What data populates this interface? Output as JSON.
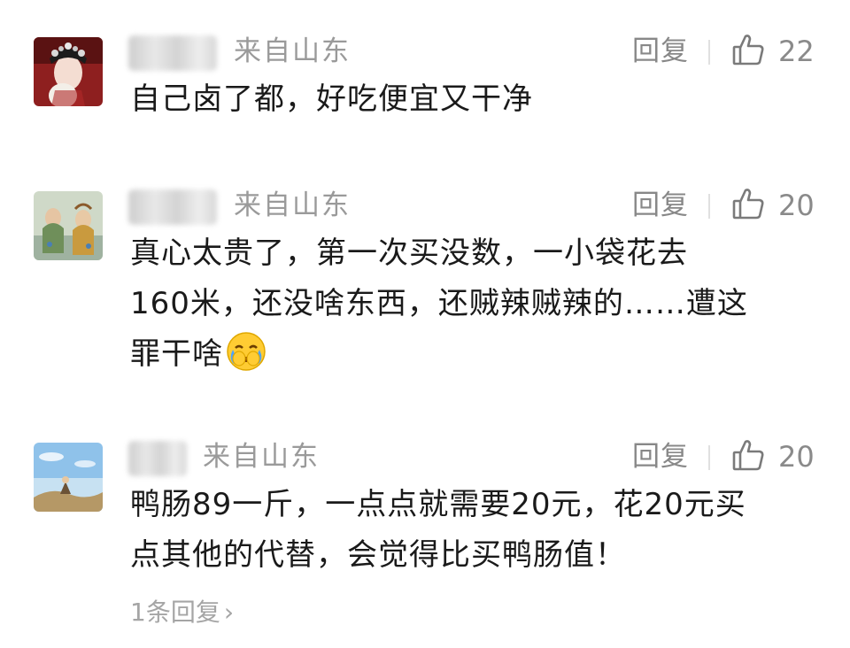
{
  "comments": [
    {
      "location": "来自山东",
      "reply_label": "回复",
      "likes": "22",
      "lines": [
        "自己卤了都，好吃便宜又干净"
      ],
      "avatar_icon": "opera-performer-avatar"
    },
    {
      "location": "来自山东",
      "reply_label": "回复",
      "likes": "20",
      "lines": [
        "真心太贵了，第一次买没数，一小袋花去",
        "160米，还没啥东西，还贼辣贼辣的……遭这",
        "罪干啥"
      ],
      "emoji": "crying-face-emoji",
      "avatar_icon": "figures-painting-avatar"
    },
    {
      "location": "来自山东",
      "reply_label": "回复",
      "likes": "20",
      "lines": [
        "鸭肠89一斤，一点点就需要20元，花20元买",
        "点其他的代替，会觉得比买鸭肠值！"
      ],
      "avatar_icon": "landscape-sky-avatar"
    }
  ],
  "reply_count": "1条回复",
  "reply_chevron": "›",
  "colors": {
    "meta": "#9a9a9a",
    "body": "#1a1a1a",
    "reply_count": "#a5a5a5"
  }
}
